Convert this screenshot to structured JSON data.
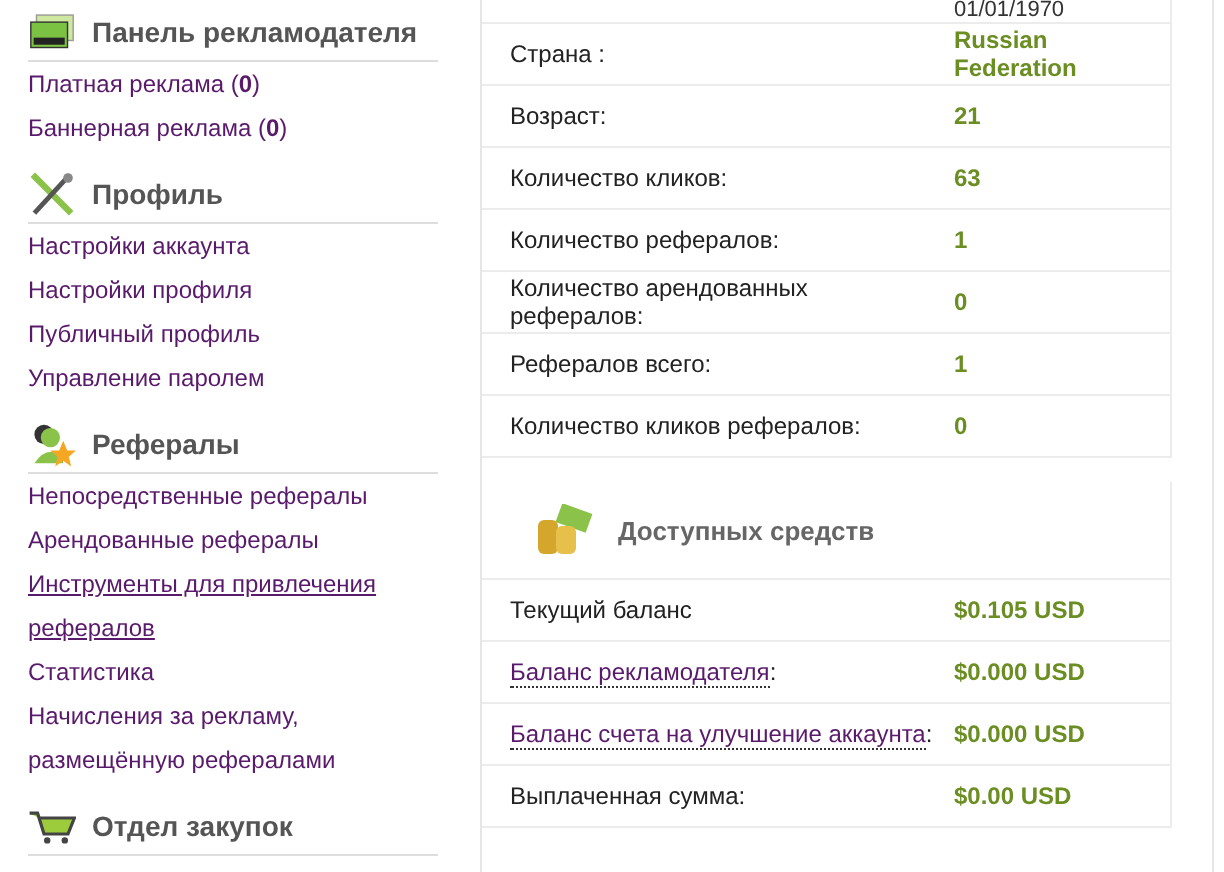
{
  "sidebar": {
    "sections": [
      {
        "title": "Панель рекламодателя",
        "links": [
          {
            "text": "Платная реклама (**0**)",
            "underlined": false
          },
          {
            "text": "Баннерная реклама (**0**)",
            "underlined": false
          }
        ]
      },
      {
        "title": "Профиль",
        "links": [
          {
            "text": "Настройки аккаунта",
            "underlined": false
          },
          {
            "text": "Настройки профиля",
            "underlined": false
          },
          {
            "text": "Публичный профиль",
            "underlined": false
          },
          {
            "text": "Управление паролем",
            "underlined": false
          }
        ]
      },
      {
        "title": "Рефералы",
        "links": [
          {
            "text": "Непосредственные рефералы",
            "underlined": false
          },
          {
            "text": "Арендованные рефералы",
            "underlined": false
          },
          {
            "text": "Инструменты для привлечения рефералов",
            "underlined": true
          },
          {
            "text": "Статистика",
            "underlined": false
          },
          {
            "text": "Начисления за рекламу, размещённую рефералами",
            "underlined": false
          }
        ]
      },
      {
        "title": "Отдел закупок"
      }
    ]
  },
  "stats": {
    "rows": [
      {
        "label": "",
        "value": "01/01/1970"
      },
      {
        "label": "Страна :",
        "value": "Russian Federation"
      },
      {
        "label": "Возраст:",
        "value": "21"
      },
      {
        "label": "Количество кликов:",
        "value": "63"
      },
      {
        "label": "Количество рефералов:",
        "value": "1"
      },
      {
        "label": "Количество арендованных рефералов:",
        "value": "0"
      },
      {
        "label": "Рефералов всего:",
        "value": "1"
      },
      {
        "label": "Количество кликов рефералов:",
        "value": "0"
      }
    ]
  },
  "funds": {
    "title": "Доступных средств",
    "rows": [
      {
        "label": "Текущий баланс",
        "kind": "text",
        "value": "$0.105 USD"
      },
      {
        "label": "Баланс рекламодателя",
        "kind": "link",
        "suffix": ":",
        "value": "$0.000 USD"
      },
      {
        "label": "Баланс счета на улучшение аккаунта",
        "kind": "link",
        "suffix": ":",
        "value": "$0.000 USD"
      },
      {
        "label": "Выплаченная сумма:",
        "kind": "text",
        "value": "$0.00 USD"
      }
    ]
  }
}
